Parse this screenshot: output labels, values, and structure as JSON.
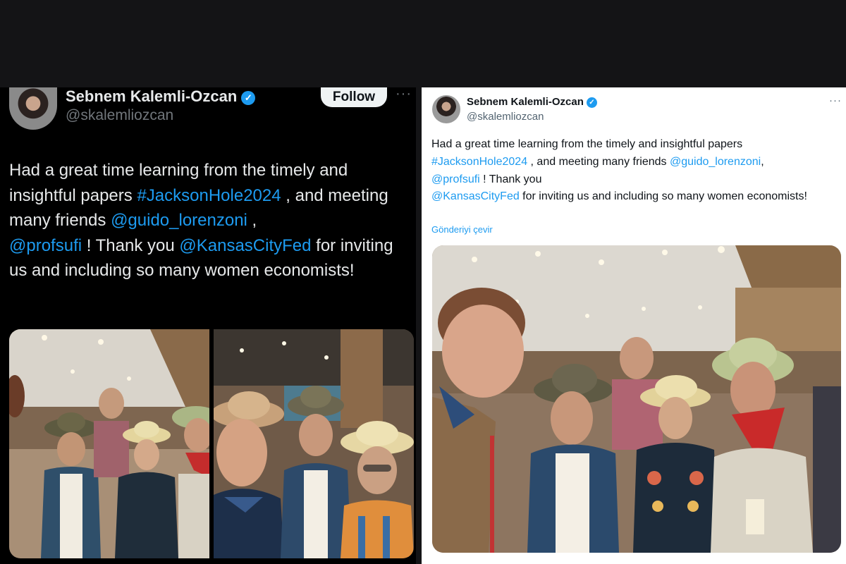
{
  "dark_tweet": {
    "author_name": "Sebnem Kalemli-Ozcan",
    "author_handle": "@skalemliozcan",
    "verified_mark": "✓",
    "follow_label": "Follow",
    "more_label": "···",
    "text_1": "Had a great time learning from the timely and insightful papers ",
    "hashtag": "#JacksonHole2024",
    "text_2": " , and meeting many friends ",
    "mention_1": "@guido_lorenzoni",
    "text_3": " , ",
    "mention_2": "@profsufi",
    "text_4": " ! Thank you ",
    "mention_3": "@KansasCityFed",
    "text_5": " for inviting us and including so many  women economists!"
  },
  "light_tweet": {
    "author_name": "Sebnem Kalemli-Ozcan",
    "author_handle": "@skalemliozcan",
    "verified_mark": "✓",
    "more_label": "···",
    "text_1": "Had a great time learning from the timely and insightful papers ",
    "hashtag": "#JacksonHole2024",
    "text_2": " , and meeting many friends ",
    "mention_1": "@guido_lorenzoni",
    "text_3": ",",
    "mention_2": "@profsufi",
    "text_4": " ! Thank you",
    "mention_3": "@KansasCityFed",
    "text_5": " for inviting us and including so many  women economists!",
    "translate_label": "Gönderiyi çevir"
  },
  "colors": {
    "link": "#1d9bf0",
    "dark_bg": "#000000",
    "light_bg": "#ffffff"
  }
}
